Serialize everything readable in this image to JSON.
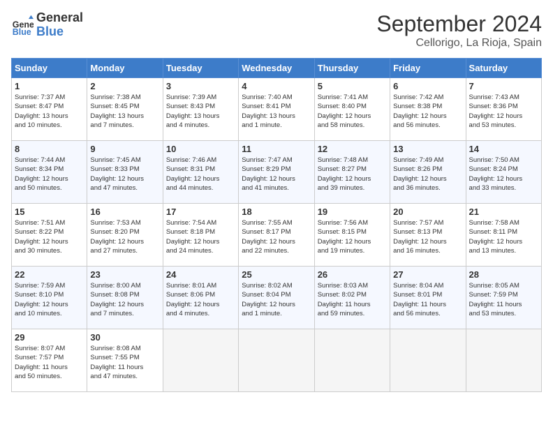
{
  "header": {
    "logo_line1": "General",
    "logo_line2": "Blue",
    "month": "September 2024",
    "location": "Cellorigo, La Rioja, Spain"
  },
  "columns": [
    "Sunday",
    "Monday",
    "Tuesday",
    "Wednesday",
    "Thursday",
    "Friday",
    "Saturday"
  ],
  "weeks": [
    [
      {
        "day": "1",
        "info": "Sunrise: 7:37 AM\nSunset: 8:47 PM\nDaylight: 13 hours\nand 10 minutes."
      },
      {
        "day": "2",
        "info": "Sunrise: 7:38 AM\nSunset: 8:45 PM\nDaylight: 13 hours\nand 7 minutes."
      },
      {
        "day": "3",
        "info": "Sunrise: 7:39 AM\nSunset: 8:43 PM\nDaylight: 13 hours\nand 4 minutes."
      },
      {
        "day": "4",
        "info": "Sunrise: 7:40 AM\nSunset: 8:41 PM\nDaylight: 13 hours\nand 1 minute."
      },
      {
        "day": "5",
        "info": "Sunrise: 7:41 AM\nSunset: 8:40 PM\nDaylight: 12 hours\nand 58 minutes."
      },
      {
        "day": "6",
        "info": "Sunrise: 7:42 AM\nSunset: 8:38 PM\nDaylight: 12 hours\nand 56 minutes."
      },
      {
        "day": "7",
        "info": "Sunrise: 7:43 AM\nSunset: 8:36 PM\nDaylight: 12 hours\nand 53 minutes."
      }
    ],
    [
      {
        "day": "8",
        "info": "Sunrise: 7:44 AM\nSunset: 8:34 PM\nDaylight: 12 hours\nand 50 minutes."
      },
      {
        "day": "9",
        "info": "Sunrise: 7:45 AM\nSunset: 8:33 PM\nDaylight: 12 hours\nand 47 minutes."
      },
      {
        "day": "10",
        "info": "Sunrise: 7:46 AM\nSunset: 8:31 PM\nDaylight: 12 hours\nand 44 minutes."
      },
      {
        "day": "11",
        "info": "Sunrise: 7:47 AM\nSunset: 8:29 PM\nDaylight: 12 hours\nand 41 minutes."
      },
      {
        "day": "12",
        "info": "Sunrise: 7:48 AM\nSunset: 8:27 PM\nDaylight: 12 hours\nand 39 minutes."
      },
      {
        "day": "13",
        "info": "Sunrise: 7:49 AM\nSunset: 8:26 PM\nDaylight: 12 hours\nand 36 minutes."
      },
      {
        "day": "14",
        "info": "Sunrise: 7:50 AM\nSunset: 8:24 PM\nDaylight: 12 hours\nand 33 minutes."
      }
    ],
    [
      {
        "day": "15",
        "info": "Sunrise: 7:51 AM\nSunset: 8:22 PM\nDaylight: 12 hours\nand 30 minutes."
      },
      {
        "day": "16",
        "info": "Sunrise: 7:53 AM\nSunset: 8:20 PM\nDaylight: 12 hours\nand 27 minutes."
      },
      {
        "day": "17",
        "info": "Sunrise: 7:54 AM\nSunset: 8:18 PM\nDaylight: 12 hours\nand 24 minutes."
      },
      {
        "day": "18",
        "info": "Sunrise: 7:55 AM\nSunset: 8:17 PM\nDaylight: 12 hours\nand 22 minutes."
      },
      {
        "day": "19",
        "info": "Sunrise: 7:56 AM\nSunset: 8:15 PM\nDaylight: 12 hours\nand 19 minutes."
      },
      {
        "day": "20",
        "info": "Sunrise: 7:57 AM\nSunset: 8:13 PM\nDaylight: 12 hours\nand 16 minutes."
      },
      {
        "day": "21",
        "info": "Sunrise: 7:58 AM\nSunset: 8:11 PM\nDaylight: 12 hours\nand 13 minutes."
      }
    ],
    [
      {
        "day": "22",
        "info": "Sunrise: 7:59 AM\nSunset: 8:10 PM\nDaylight: 12 hours\nand 10 minutes."
      },
      {
        "day": "23",
        "info": "Sunrise: 8:00 AM\nSunset: 8:08 PM\nDaylight: 12 hours\nand 7 minutes."
      },
      {
        "day": "24",
        "info": "Sunrise: 8:01 AM\nSunset: 8:06 PM\nDaylight: 12 hours\nand 4 minutes."
      },
      {
        "day": "25",
        "info": "Sunrise: 8:02 AM\nSunset: 8:04 PM\nDaylight: 12 hours\nand 1 minute."
      },
      {
        "day": "26",
        "info": "Sunrise: 8:03 AM\nSunset: 8:02 PM\nDaylight: 11 hours\nand 59 minutes."
      },
      {
        "day": "27",
        "info": "Sunrise: 8:04 AM\nSunset: 8:01 PM\nDaylight: 11 hours\nand 56 minutes."
      },
      {
        "day": "28",
        "info": "Sunrise: 8:05 AM\nSunset: 7:59 PM\nDaylight: 11 hours\nand 53 minutes."
      }
    ],
    [
      {
        "day": "29",
        "info": "Sunrise: 8:07 AM\nSunset: 7:57 PM\nDaylight: 11 hours\nand 50 minutes."
      },
      {
        "day": "30",
        "info": "Sunrise: 8:08 AM\nSunset: 7:55 PM\nDaylight: 11 hours\nand 47 minutes."
      },
      {
        "day": "",
        "info": ""
      },
      {
        "day": "",
        "info": ""
      },
      {
        "day": "",
        "info": ""
      },
      {
        "day": "",
        "info": ""
      },
      {
        "day": "",
        "info": ""
      }
    ]
  ]
}
